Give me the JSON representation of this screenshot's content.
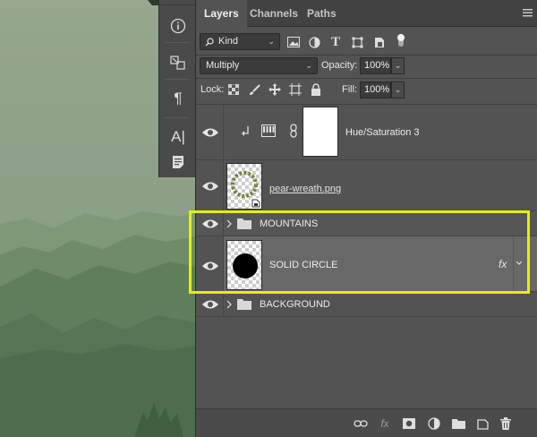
{
  "panel": {
    "tabs": [
      "Layers",
      "Channels",
      "Paths"
    ],
    "active_tab": "Layers"
  },
  "filter": {
    "kind_label": "Kind",
    "icons": [
      "image-filter-icon",
      "adjustment-filter-icon",
      "type-filter-icon",
      "shape-filter-icon",
      "smart-object-filter-icon",
      "filter-toggle-icon"
    ]
  },
  "blend": {
    "mode": "Multiply",
    "opacity_label": "Opacity:",
    "opacity_value": "100%"
  },
  "lock": {
    "label": "Lock:",
    "fill_label": "Fill:",
    "fill_value": "100%",
    "icons": [
      "lock-transparent-icon",
      "lock-paint-icon",
      "lock-position-icon",
      "lock-artboard-icon",
      "lock-all-icon"
    ]
  },
  "layers": [
    {
      "name": "Hue/Saturation 3",
      "type": "adjustment",
      "visible": true,
      "clipped": true
    },
    {
      "name": "pear-wreath.png",
      "type": "smart-object",
      "visible": true
    },
    {
      "name": "MOUNTAINS",
      "type": "group",
      "visible": true,
      "expanded": false
    },
    {
      "name": "SOLID CIRCLE",
      "type": "shape",
      "visible": true,
      "selected": true,
      "fx": "fx"
    },
    {
      "name": "BACKGROUND",
      "type": "group",
      "visible": true,
      "expanded": false
    }
  ],
  "bottom_bar": {
    "icons": [
      "link-layers-icon",
      "fx-icon",
      "add-mask-icon",
      "new-fill-adjustment-icon",
      "new-group-icon",
      "new-layer-icon",
      "delete-layer-icon"
    ]
  },
  "toolstrip": {
    "icons": [
      "info-icon",
      "swap-icon",
      "paragraph-icon",
      "character-icon",
      "notes-icon"
    ],
    "paragraph_glyph": "¶",
    "character_glyph": "A|"
  },
  "colors": {
    "highlight": "#e6f000",
    "panel_bg": "#535353",
    "selected_row": "#686868"
  }
}
